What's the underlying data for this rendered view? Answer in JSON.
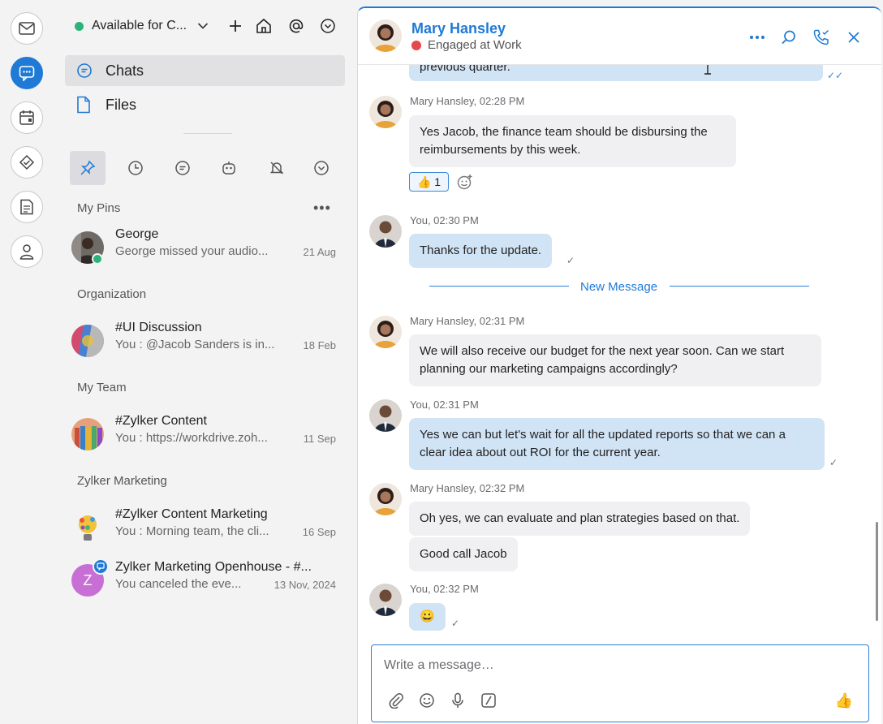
{
  "status": {
    "label": "Available for C..."
  },
  "nav": {
    "chats": "Chats",
    "files": "Files"
  },
  "sections": {
    "pins": "My Pins",
    "org": "Organization",
    "team": "My Team",
    "marketing": "Zylker Marketing",
    "more": "•••"
  },
  "chats": [
    {
      "title": "George",
      "preview": "George missed your audio...",
      "date": "21 Aug"
    },
    {
      "title": "#UI Discussion",
      "preview": "You : @Jacob Sanders  is in...",
      "date": "18 Feb"
    },
    {
      "title": "#Zylker Content",
      "preview": "You : https://workdrive.zoh...",
      "date": "11 Sep"
    },
    {
      "title": "#Zylker Content Marketing",
      "preview": "You : Morning team, the cli...",
      "date": "16 Sep"
    },
    {
      "title": "Zylker Marketing Openhouse - #...",
      "preview": "You canceled the eve...",
      "date": "13 Nov, 2024",
      "avatar_letter": "Z"
    }
  ],
  "conversation": {
    "name": "Mary Hansley",
    "status": "Engaged at Work",
    "new_message": "New Message",
    "reaction": "👍 1",
    "messages": [
      {
        "meta": "",
        "text": "previous quarter."
      },
      {
        "meta": "Mary  Hansley, 02:28 PM",
        "text": "Yes Jacob, the finance team should be disbursing the reimbursements by this week."
      },
      {
        "meta": "You, 02:30 PM",
        "text": "Thanks for the update."
      },
      {
        "meta": "Mary  Hansley, 02:31 PM",
        "text": "We will also receive our budget for the next year soon. Can we start planning our marketing campaigns accordingly?"
      },
      {
        "meta": "You, 02:31 PM",
        "text": "Yes we can but let's wait for all the updated reports so that we can a clear idea about out ROI for the current year."
      },
      {
        "meta": "Mary  Hansley, 02:32 PM",
        "text": "Oh yes, we can evaluate and plan strategies based on that."
      },
      {
        "meta": "",
        "text": "Good call Jacob"
      },
      {
        "meta": "You, 02:32 PM",
        "text": "😀"
      }
    ]
  },
  "composer": {
    "placeholder": "Write a message…",
    "like": "👍"
  },
  "colors": {
    "accent": "#1f7ad6",
    "online": "#2cb37b",
    "busy": "#e5484d",
    "out_bubble": "#d1e4f6"
  }
}
